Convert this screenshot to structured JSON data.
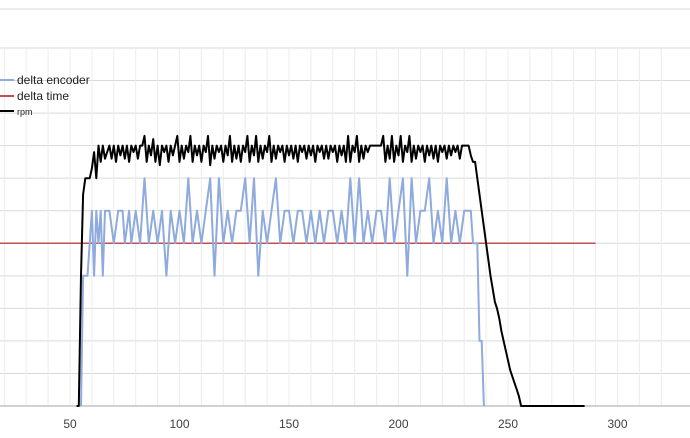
{
  "chart_data": {
    "type": "line",
    "title": "",
    "xlabel": "",
    "ylabel": "",
    "xlim": [
      0,
      320
    ],
    "ylim": [
      0,
      11
    ],
    "grid": true,
    "legend_placement": "top-left",
    "x_ticks": [
      "50",
      "100",
      "150",
      "200",
      "250",
      "300"
    ],
    "legend": [
      {
        "label": "delta encoder",
        "color": "#8faadc"
      },
      {
        "label": "delta time",
        "color": "#c0504d"
      },
      {
        "label": "rpm",
        "color": "#000000"
      }
    ],
    "series": [
      {
        "name": "delta encoder",
        "color": "#8faadc",
        "points": [
          [
            55,
            0
          ],
          [
            56,
            4
          ],
          [
            58,
            4
          ],
          [
            59,
            5
          ],
          [
            60,
            6
          ],
          [
            61,
            4
          ],
          [
            62,
            6
          ],
          [
            63,
            5
          ],
          [
            64,
            6
          ],
          [
            65,
            4
          ],
          [
            66,
            6
          ],
          [
            68,
            6
          ],
          [
            70,
            5
          ],
          [
            72,
            6
          ],
          [
            74,
            6
          ],
          [
            75,
            5
          ],
          [
            77,
            6
          ],
          [
            78,
            5
          ],
          [
            80,
            6
          ],
          [
            82,
            5
          ],
          [
            84,
            7
          ],
          [
            86,
            5
          ],
          [
            88,
            6
          ],
          [
            90,
            5
          ],
          [
            92,
            6
          ],
          [
            94,
            4
          ],
          [
            96,
            6
          ],
          [
            98,
            5
          ],
          [
            100,
            6
          ],
          [
            102,
            5
          ],
          [
            104,
            7
          ],
          [
            106,
            5
          ],
          [
            108,
            6
          ],
          [
            110,
            5
          ],
          [
            112,
            6
          ],
          [
            114,
            7
          ],
          [
            116,
            4
          ],
          [
            118,
            7
          ],
          [
            120,
            5
          ],
          [
            122,
            6
          ],
          [
            124,
            5
          ],
          [
            126,
            6
          ],
          [
            128,
            6
          ],
          [
            130,
            7
          ],
          [
            132,
            5
          ],
          [
            134,
            7
          ],
          [
            136,
            4
          ],
          [
            138,
            6
          ],
          [
            140,
            5
          ],
          [
            142,
            6
          ],
          [
            144,
            7
          ],
          [
            146,
            5
          ],
          [
            148,
            6
          ],
          [
            150,
            6
          ],
          [
            152,
            5
          ],
          [
            154,
            6
          ],
          [
            156,
            6
          ],
          [
            158,
            5
          ],
          [
            160,
            6
          ],
          [
            162,
            5
          ],
          [
            164,
            6
          ],
          [
            166,
            5
          ],
          [
            168,
            6
          ],
          [
            170,
            6
          ],
          [
            172,
            5
          ],
          [
            174,
            6
          ],
          [
            176,
            5
          ],
          [
            178,
            7
          ],
          [
            180,
            5
          ],
          [
            182,
            7
          ],
          [
            184,
            5
          ],
          [
            186,
            6
          ],
          [
            188,
            5
          ],
          [
            190,
            6
          ],
          [
            192,
            6
          ],
          [
            194,
            5
          ],
          [
            196,
            7
          ],
          [
            198,
            5
          ],
          [
            200,
            6
          ],
          [
            202,
            7
          ],
          [
            204,
            4
          ],
          [
            206,
            7
          ],
          [
            208,
            5
          ],
          [
            210,
            6
          ],
          [
            212,
            6
          ],
          [
            214,
            7
          ],
          [
            216,
            5
          ],
          [
            218,
            6
          ],
          [
            220,
            5
          ],
          [
            222,
            7
          ],
          [
            224,
            5
          ],
          [
            226,
            6
          ],
          [
            228,
            5
          ],
          [
            230,
            6
          ],
          [
            233,
            6
          ],
          [
            234,
            5
          ],
          [
            236,
            5
          ],
          [
            237,
            2
          ],
          [
            238,
            2
          ],
          [
            239,
            0
          ]
        ]
      },
      {
        "name": "delta time",
        "color": "#c0504d",
        "points": [
          [
            0,
            5
          ],
          [
            290,
            5
          ]
        ]
      },
      {
        "name": "rpm",
        "color": "#000000",
        "points": [
          [
            53,
            0
          ],
          [
            54,
            0
          ],
          [
            55,
            4
          ],
          [
            56,
            6.5
          ],
          [
            57,
            7
          ],
          [
            59,
            7
          ],
          [
            60,
            7.3
          ],
          [
            61,
            7.8
          ],
          [
            62,
            7
          ],
          [
            63,
            8
          ],
          [
            64,
            7.5
          ],
          [
            65,
            8
          ],
          [
            66,
            7.6
          ],
          [
            67,
            7.8
          ],
          [
            68,
            8
          ],
          [
            69,
            7.6
          ],
          [
            70,
            8
          ],
          [
            71,
            7.5
          ],
          [
            72,
            8
          ],
          [
            73,
            7.7
          ],
          [
            74,
            8
          ],
          [
            75,
            7.6
          ],
          [
            76,
            8
          ],
          [
            77,
            7.5
          ],
          [
            78,
            8
          ],
          [
            79,
            7.8
          ],
          [
            80,
            8
          ],
          [
            81,
            7.6
          ],
          [
            82,
            8
          ],
          [
            83,
            8
          ],
          [
            84,
            8.3
          ],
          [
            85,
            7.5
          ],
          [
            86,
            8
          ],
          [
            87,
            7.7
          ],
          [
            88,
            8.2
          ],
          [
            89,
            7.5
          ],
          [
            90,
            8
          ],
          [
            91,
            7.4
          ],
          [
            92,
            8
          ],
          [
            93,
            7.8
          ],
          [
            94,
            8
          ],
          [
            95,
            7.5
          ],
          [
            96,
            8
          ],
          [
            97,
            7.7
          ],
          [
            98,
            8
          ],
          [
            99,
            8.3
          ],
          [
            100,
            7.5
          ],
          [
            101,
            8
          ],
          [
            102,
            7.6
          ],
          [
            103,
            8
          ],
          [
            104,
            7.8
          ],
          [
            105,
            8.3
          ],
          [
            106,
            7.5
          ],
          [
            107,
            8
          ],
          [
            108,
            7.7
          ],
          [
            109,
            8
          ],
          [
            110,
            7.5
          ],
          [
            111,
            8
          ],
          [
            112,
            7.8
          ],
          [
            113,
            8.3
          ],
          [
            114,
            7.4
          ],
          [
            115,
            8
          ],
          [
            116,
            7.6
          ],
          [
            117,
            8
          ],
          [
            118,
            7.8
          ],
          [
            119,
            8
          ],
          [
            120,
            7.5
          ],
          [
            121,
            8
          ],
          [
            122,
            7.7
          ],
          [
            123,
            8.3
          ],
          [
            124,
            7.5
          ],
          [
            125,
            8
          ],
          [
            126,
            7.6
          ],
          [
            127,
            8
          ],
          [
            128,
            7.5
          ],
          [
            129,
            8
          ],
          [
            130,
            7.8
          ],
          [
            131,
            8.3
          ],
          [
            132,
            7.5
          ],
          [
            133,
            8
          ],
          [
            134,
            7.7
          ],
          [
            135,
            8.3
          ],
          [
            136,
            7.5
          ],
          [
            137,
            8
          ],
          [
            138,
            7.6
          ],
          [
            139,
            8
          ],
          [
            140,
            7.8
          ],
          [
            141,
            8.3
          ],
          [
            142,
            7.5
          ],
          [
            143,
            8
          ],
          [
            144,
            7.6
          ],
          [
            145,
            8
          ],
          [
            146,
            7.8
          ],
          [
            147,
            8
          ],
          [
            148,
            7.5
          ],
          [
            149,
            8
          ],
          [
            150,
            7.7
          ],
          [
            151,
            8
          ],
          [
            152,
            7.6
          ],
          [
            153,
            8
          ],
          [
            154,
            7.5
          ],
          [
            155,
            8
          ],
          [
            156,
            7.8
          ],
          [
            157,
            8
          ],
          [
            158,
            7.6
          ],
          [
            159,
            8
          ],
          [
            160,
            7.7
          ],
          [
            161,
            8
          ],
          [
            162,
            7.5
          ],
          [
            163,
            8
          ],
          [
            164,
            7.8
          ],
          [
            165,
            8
          ],
          [
            166,
            7.6
          ],
          [
            167,
            8
          ],
          [
            168,
            7.6
          ],
          [
            169,
            8
          ],
          [
            170,
            7.8
          ],
          [
            171,
            8
          ],
          [
            172,
            7.5
          ],
          [
            173,
            8
          ],
          [
            174,
            7.7
          ],
          [
            175,
            8
          ],
          [
            176,
            7.5
          ],
          [
            177,
            8.3
          ],
          [
            178,
            7.5
          ],
          [
            179,
            8
          ],
          [
            180,
            7.8
          ],
          [
            181,
            8.3
          ],
          [
            182,
            7.5
          ],
          [
            183,
            8
          ],
          [
            184,
            7.6
          ],
          [
            185,
            8
          ],
          [
            186,
            7.8
          ],
          [
            187,
            8
          ],
          [
            188,
            8
          ],
          [
            189,
            8
          ],
          [
            190,
            8
          ],
          [
            192,
            8
          ],
          [
            193,
            8.3
          ],
          [
            194,
            7.5
          ],
          [
            195,
            8
          ],
          [
            196,
            7.6
          ],
          [
            197,
            8.3
          ],
          [
            198,
            7.5
          ],
          [
            199,
            8
          ],
          [
            200,
            7.7
          ],
          [
            201,
            8.3
          ],
          [
            202,
            7.5
          ],
          [
            203,
            8
          ],
          [
            204,
            7.8
          ],
          [
            205,
            8.3
          ],
          [
            206,
            7.5
          ],
          [
            207,
            8
          ],
          [
            208,
            7.6
          ],
          [
            209,
            8
          ],
          [
            210,
            7.8
          ],
          [
            211,
            8
          ],
          [
            212,
            7.5
          ],
          [
            213,
            8
          ],
          [
            214,
            7.7
          ],
          [
            215,
            8
          ],
          [
            216,
            7.6
          ],
          [
            217,
            8
          ],
          [
            218,
            7.5
          ],
          [
            219,
            8
          ],
          [
            220,
            7.8
          ],
          [
            221,
            8
          ],
          [
            222,
            7.6
          ],
          [
            223,
            8
          ],
          [
            224,
            7.7
          ],
          [
            225,
            8
          ],
          [
            226,
            7.8
          ],
          [
            227,
            8
          ],
          [
            228,
            7.6
          ],
          [
            229,
            8
          ],
          [
            230,
            8
          ],
          [
            231,
            8
          ],
          [
            232,
            8
          ],
          [
            233,
            7.7
          ],
          [
            234,
            7.5
          ],
          [
            235,
            7.5
          ],
          [
            236,
            7
          ],
          [
            237,
            6.5
          ],
          [
            238,
            6
          ],
          [
            239,
            5.5
          ],
          [
            240,
            5
          ],
          [
            241,
            4.5
          ],
          [
            242,
            4
          ],
          [
            243,
            3.6
          ],
          [
            244,
            3.2
          ],
          [
            245,
            3
          ],
          [
            246,
            2.7
          ],
          [
            247,
            2.3
          ],
          [
            248,
            2
          ],
          [
            249,
            1.7
          ],
          [
            250,
            1.4
          ],
          [
            251,
            1.1
          ],
          [
            252,
            0.9
          ],
          [
            253,
            0.7
          ],
          [
            254,
            0.5
          ],
          [
            255,
            0.3
          ],
          [
            256,
            0
          ],
          [
            260,
            0
          ],
          [
            285,
            0
          ]
        ]
      }
    ]
  }
}
